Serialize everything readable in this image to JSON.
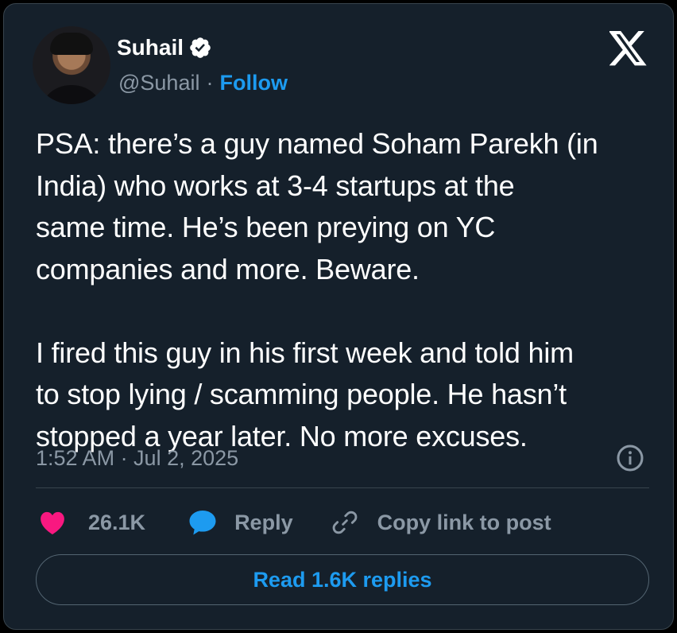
{
  "author": {
    "name": "Suhail",
    "handle": "@Suhail",
    "separator": "·",
    "follow_label": "Follow"
  },
  "tweet": {
    "text": "PSA: there’s a guy named Soham Parekh (in\nIndia) who works at 3-4 startups at the\nsame time. He’s been preying on YC\ncompanies and more. Beware.\n\nI fired this guy in his first week and told him\nto stop lying / scamming people. He hasn’t\nstopped a year later. No more excuses.",
    "timestamp": "1:52 AM · Jul 2, 2025"
  },
  "actions": {
    "likes": "26.1K",
    "reply_label": "Reply",
    "copy_label": "Copy link to post"
  },
  "read_replies_label": "Read 1.6K replies",
  "icons": {
    "verified": "verified-badge-icon",
    "logo": "x-logo-icon",
    "info": "info-icon",
    "like": "heart-icon",
    "reply": "speech-bubble-icon",
    "copy": "link-icon"
  },
  "colors": {
    "background": "#15202b",
    "accent": "#1d9bf0",
    "like": "#f91880",
    "muted": "#8b98a5",
    "border": "#38444d"
  }
}
